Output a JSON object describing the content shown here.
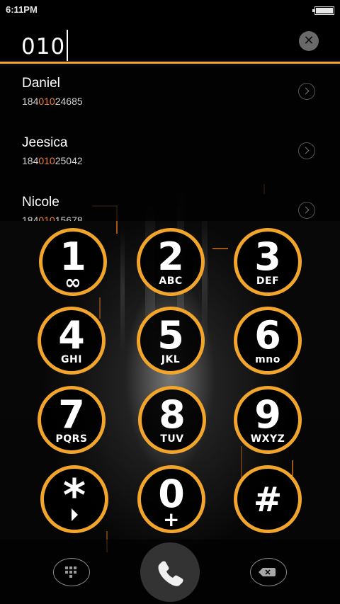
{
  "status_bar": {
    "time": "6:11PM"
  },
  "dialer": {
    "input_value": "010"
  },
  "contacts": [
    {
      "name": "Daniel",
      "number_prefix": "184",
      "number_match": "010",
      "number_suffix": "24685"
    },
    {
      "name": "Jeesica",
      "number_prefix": "184",
      "number_match": "010",
      "number_suffix": "25042"
    },
    {
      "name": "Nicole",
      "number_prefix": "184",
      "number_match": "010",
      "number_suffix": "15678"
    }
  ],
  "keypad": [
    {
      "digit": "1",
      "letters": "∞"
    },
    {
      "digit": "2",
      "letters": "ABC"
    },
    {
      "digit": "3",
      "letters": "DEF"
    },
    {
      "digit": "4",
      "letters": "GHI"
    },
    {
      "digit": "5",
      "letters": "JKL"
    },
    {
      "digit": "6",
      "letters": "mno"
    },
    {
      "digit": "7",
      "letters": "PQRS"
    },
    {
      "digit": "8",
      "letters": "TUV"
    },
    {
      "digit": "9",
      "letters": "WXYZ"
    },
    {
      "digit": "*",
      "letters": ""
    },
    {
      "digit": "0",
      "letters": "+"
    },
    {
      "digit": "#",
      "letters": ""
    }
  ],
  "colors": {
    "accent": "#f2a52b",
    "match_highlight": "#f07f3a"
  },
  "icons": {
    "clear": "close-icon",
    "contact_arrow": "chevron-right-icon",
    "keypad_toggle": "dialpad-icon",
    "call": "phone-icon",
    "backspace": "backspace-icon"
  }
}
